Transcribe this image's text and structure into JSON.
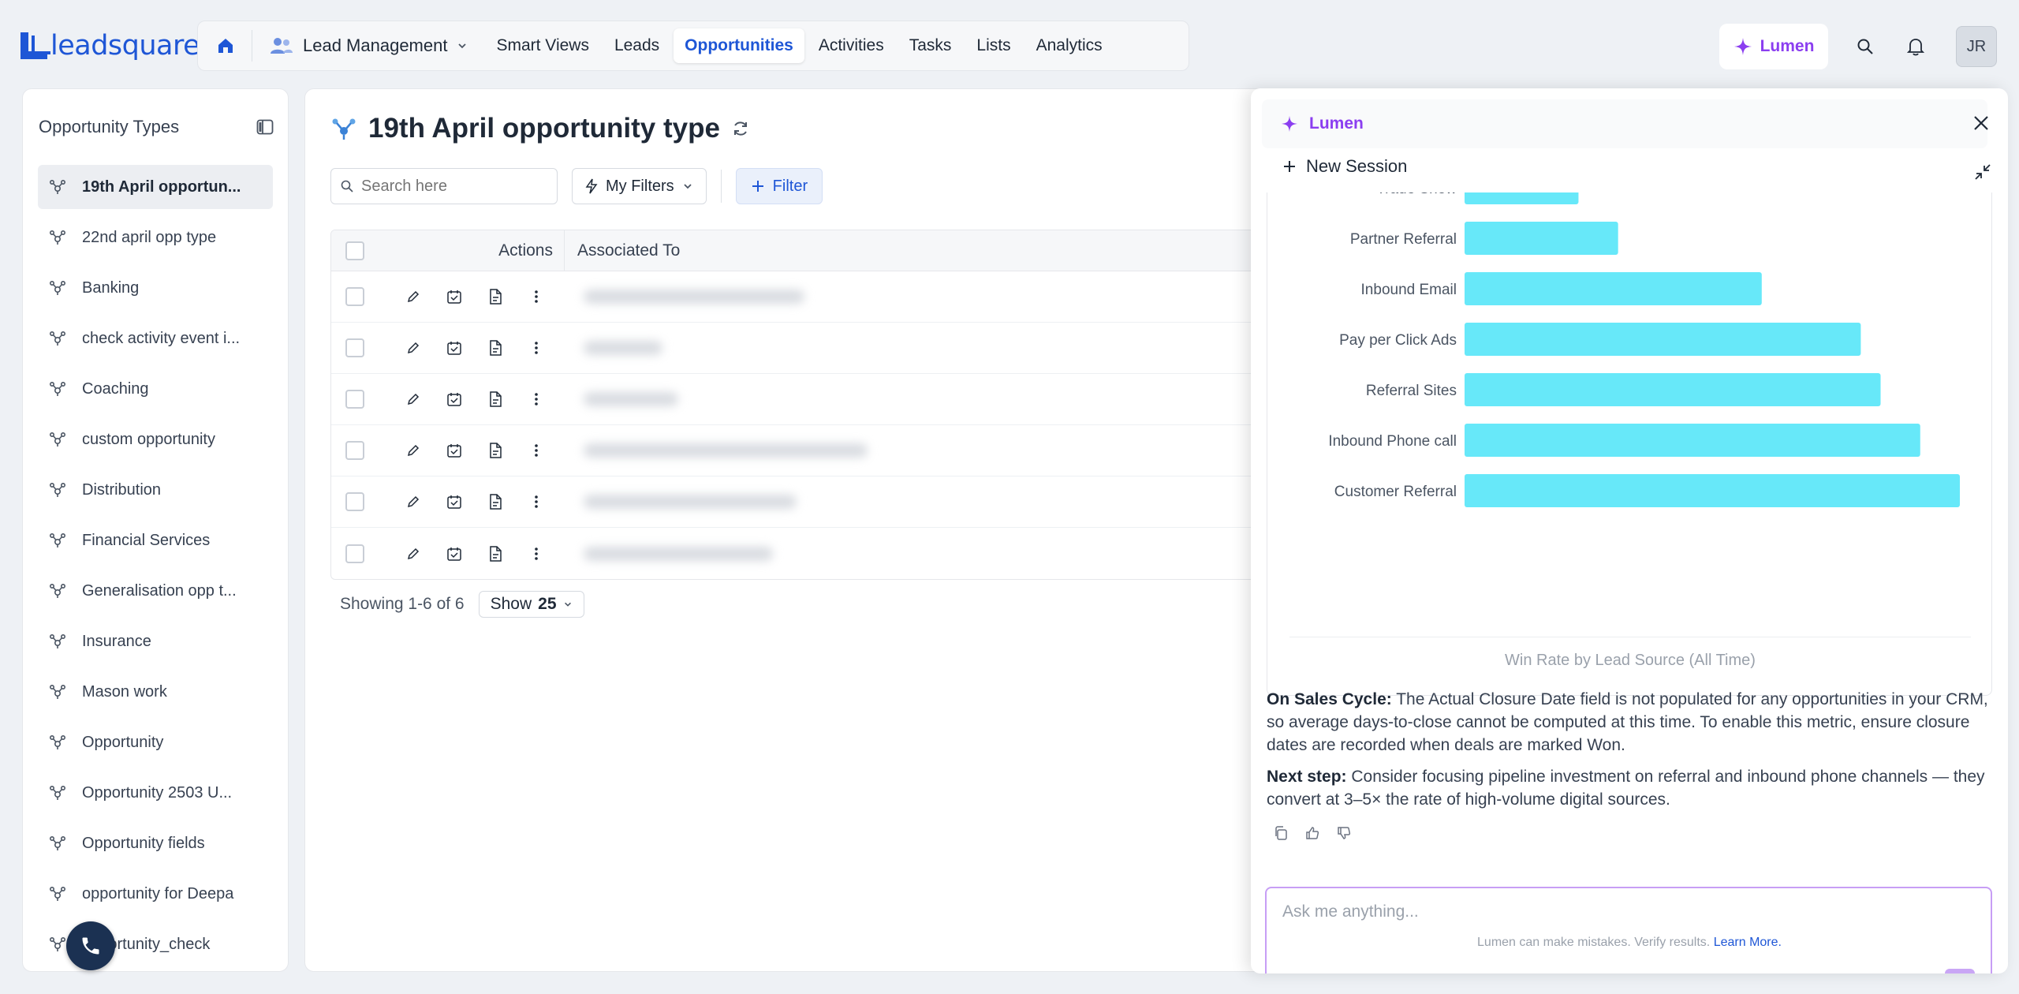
{
  "brand": {
    "logo_text": "leadsquared",
    "accent": "#1e56d6",
    "lumen_accent": "#8b3ef0"
  },
  "nav": {
    "module": "Lead Management",
    "items": [
      {
        "label": "Smart Views",
        "active": false
      },
      {
        "label": "Leads",
        "active": false
      },
      {
        "label": "Opportunities",
        "active": true
      },
      {
        "label": "Activities",
        "active": false
      },
      {
        "label": "Tasks",
        "active": false
      },
      {
        "label": "Lists",
        "active": false
      },
      {
        "label": "Analytics",
        "active": false
      }
    ],
    "lumen_label": "Lumen",
    "avatar_initials": "JR"
  },
  "sidebar": {
    "title": "Opportunity Types",
    "items": [
      {
        "label": "19th April opportun...",
        "active": true
      },
      {
        "label": "22nd april opp type"
      },
      {
        "label": "Banking"
      },
      {
        "label": "check activity event i..."
      },
      {
        "label": "Coaching"
      },
      {
        "label": "custom opportunity"
      },
      {
        "label": "Distribution"
      },
      {
        "label": "Financial Services"
      },
      {
        "label": "Generalisation opp t..."
      },
      {
        "label": "Insurance"
      },
      {
        "label": "Mason work"
      },
      {
        "label": "Opportunity"
      },
      {
        "label": "Opportunity 2503 U..."
      },
      {
        "label": "Opportunity fields"
      },
      {
        "label": "opportunity for Deepa"
      },
      {
        "label": "opportunity_check"
      }
    ]
  },
  "main": {
    "title": "19th April opportunity type",
    "search_placeholder": "Search here",
    "my_filters_label": "My Filters",
    "filter_label": "Filter",
    "table": {
      "col_actions": "Actions",
      "col_associated": "Associated To",
      "row_count": 6
    },
    "pager": {
      "showing": "Showing 1-6 of 6",
      "show_label": "Show",
      "page_size": "25"
    }
  },
  "lumen": {
    "header": "Lumen",
    "new_session": "New Session",
    "chart_data": {
      "type": "bar",
      "orientation": "horizontal",
      "title": "Win Rate by Lead Source (All Time)",
      "categories": [
        "Trade Show",
        "Partner Referral",
        "Inbound Email",
        "Pay per Click Ads",
        "Referral Sites",
        "Inbound Phone call",
        "Customer Referral"
      ],
      "values": [
        23,
        31,
        60,
        80,
        84,
        92,
        100
      ],
      "xlim": [
        0,
        100
      ],
      "color": "#67e8f9",
      "grid": false
    },
    "sales_cycle_label": "On Sales Cycle:",
    "sales_cycle_text": " The Actual Closure Date field is not populated for any opportunities in your CRM, so average days-to-close cannot be computed at this time. To enable this metric, ensure closure dates are recorded when deals are marked Won.",
    "next_step_label": "Next step:",
    "next_step_text": " Consider focusing pipeline investment on referral and inbound phone channels — they convert at 3–5× the rate of high-volume digital sources.",
    "ask_placeholder": "Ask me anything...",
    "disclaimer": "Lumen can make mistakes. Verify results.",
    "learn_more": "Learn More."
  }
}
